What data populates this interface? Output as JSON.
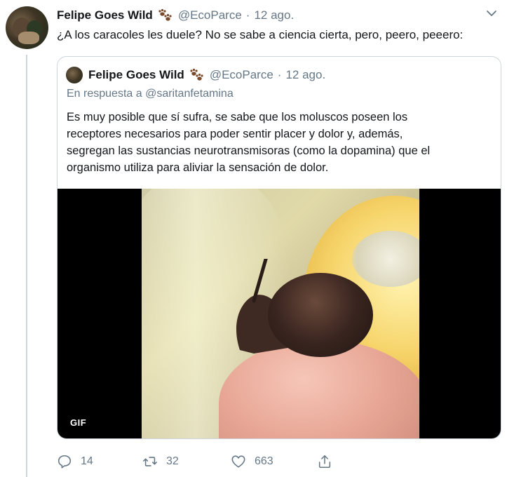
{
  "tweet": {
    "author_name": "Felipe Goes Wild",
    "author_handle": "@EcoParce",
    "separator": "·",
    "time": "12 ago.",
    "text": "¿A los caracoles les duele? No se sabe a ciencia cierta, pero, peero, peeero:"
  },
  "quoted": {
    "author_name": "Felipe Goes Wild",
    "author_handle": "@EcoParce",
    "separator": "·",
    "time": "12 ago.",
    "reply_prefix": "En respuesta a",
    "reply_handle": "@saritanfetamina",
    "body_lines": [
      "Es muy posible que sí sufra, se sabe que los moluscos poseen los",
      "receptores necesarios para poder sentir placer y dolor y, además,",
      "segregan las sustancias neurotransmisoras (como la dopamina) que el",
      "organismo utiliza para aliviar la sensación de dolor."
    ],
    "media_badge": "GIF"
  },
  "actions": {
    "reply_count": "14",
    "retweet_count": "32",
    "like_count": "663"
  },
  "icons": {
    "paw": "paw-prints-icon",
    "caret": "chevron-down-icon",
    "reply": "reply-icon",
    "retweet": "retweet-icon",
    "like": "heart-icon",
    "share": "share-icon"
  },
  "colors": {
    "muted": "#657786",
    "border": "#ccd6dd",
    "text": "#14171a"
  }
}
